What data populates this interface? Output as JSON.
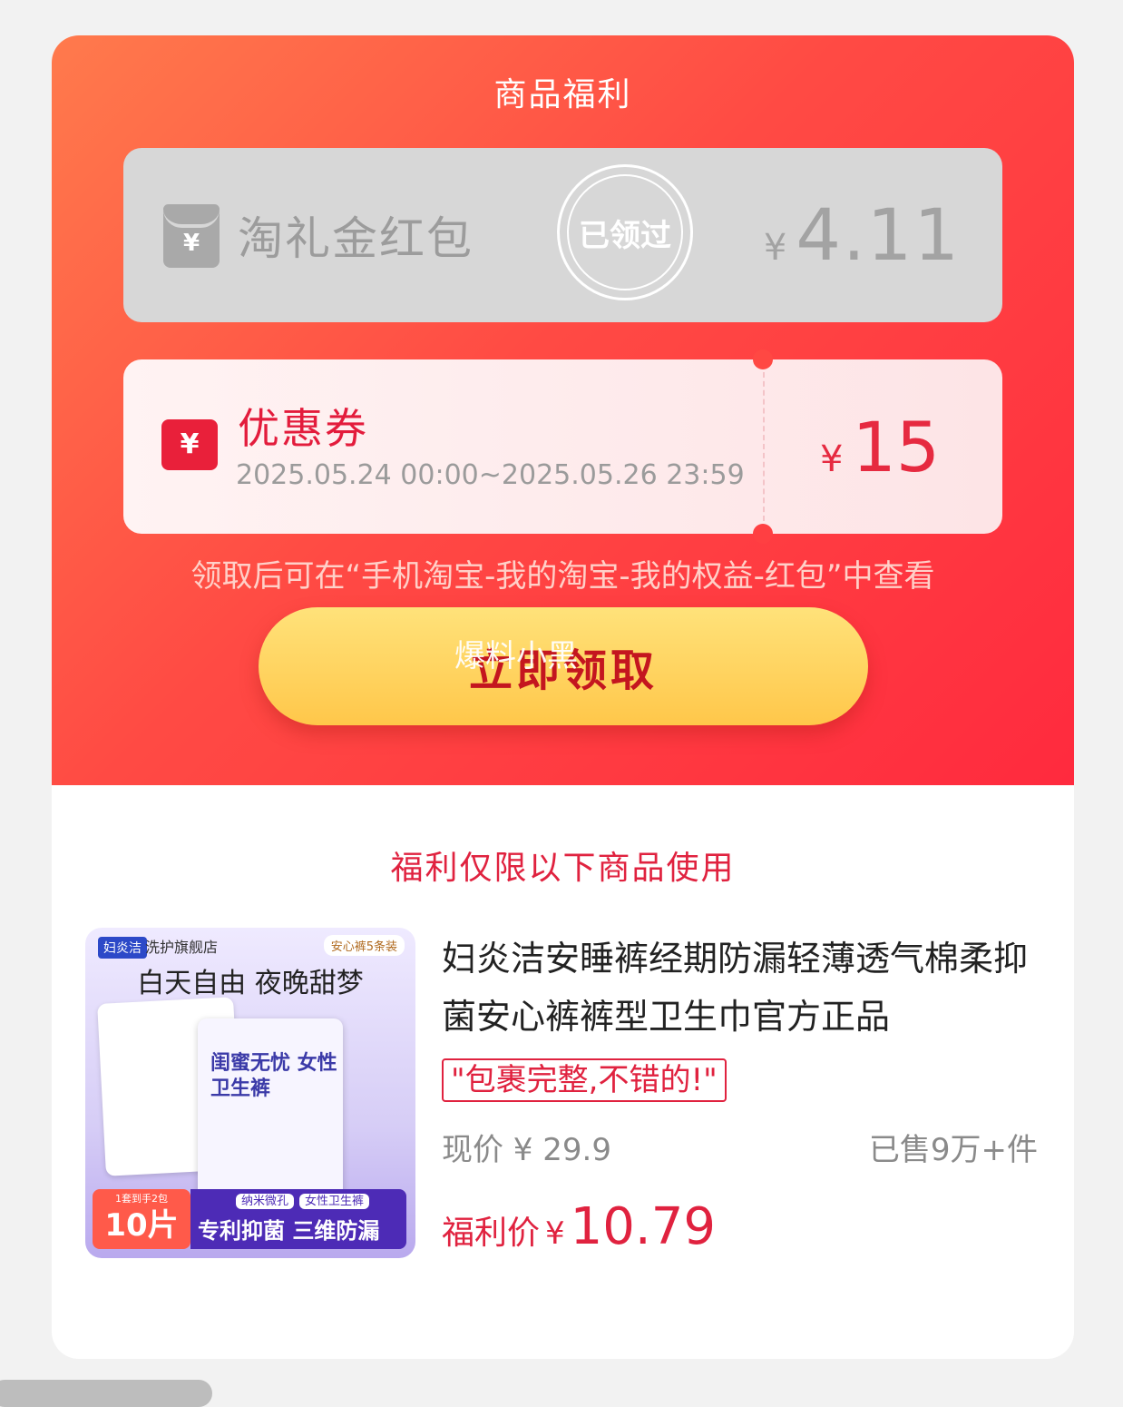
{
  "header": {
    "title": "商品福利"
  },
  "red_packet": {
    "icon": "red-packet-icon",
    "icon_glyph": "¥",
    "name": "淘礼金红包",
    "status_stamp": "已领过",
    "currency": "¥",
    "amount": "4.11"
  },
  "coupon": {
    "icon": "coupon-icon",
    "icon_glyph": "¥",
    "name": "优惠券",
    "validity": "2025.05.24 00:00~2025.05.26 23:59",
    "currency": "¥",
    "amount": "15"
  },
  "hint": "领取后可在“手机淘宝-我的淘宝-我的权益-红包”中查看",
  "claim_button": {
    "label": "立即领取"
  },
  "watermark": "爆料小黑",
  "restriction_note": "福利仅限以下商品使用",
  "product": {
    "image": {
      "brand": "妇炎洁",
      "store": "洗护旗舰店",
      "pack": "安心裤5条装",
      "slogan": "白天自由 夜晚甜梦",
      "bag_text": "闺蜜无忧 女性卫生裤",
      "pieces_small": "1套到手2包",
      "pieces": "10片",
      "tag1": "纳米微孔",
      "tag2": "女性卫生裤",
      "feature": "专利抑菌 三维防漏"
    },
    "title": "妇炎洁安睡裤经期防漏轻薄透气棉柔抑菌安心裤裤型卫生巾官方正品",
    "review": "\"包裹完整,不错的!\"",
    "current_price": "现价 ¥ 29.9",
    "sold": "已售9万+件",
    "deal_label": "福利价",
    "deal_currency": "¥",
    "deal_price": "10.79"
  },
  "colors": {
    "primary_red": "#e0223f",
    "header_gradient_start": "#ff7a4c",
    "header_gradient_end": "#ff2a3e",
    "button_yellow": "#ffc74a"
  }
}
